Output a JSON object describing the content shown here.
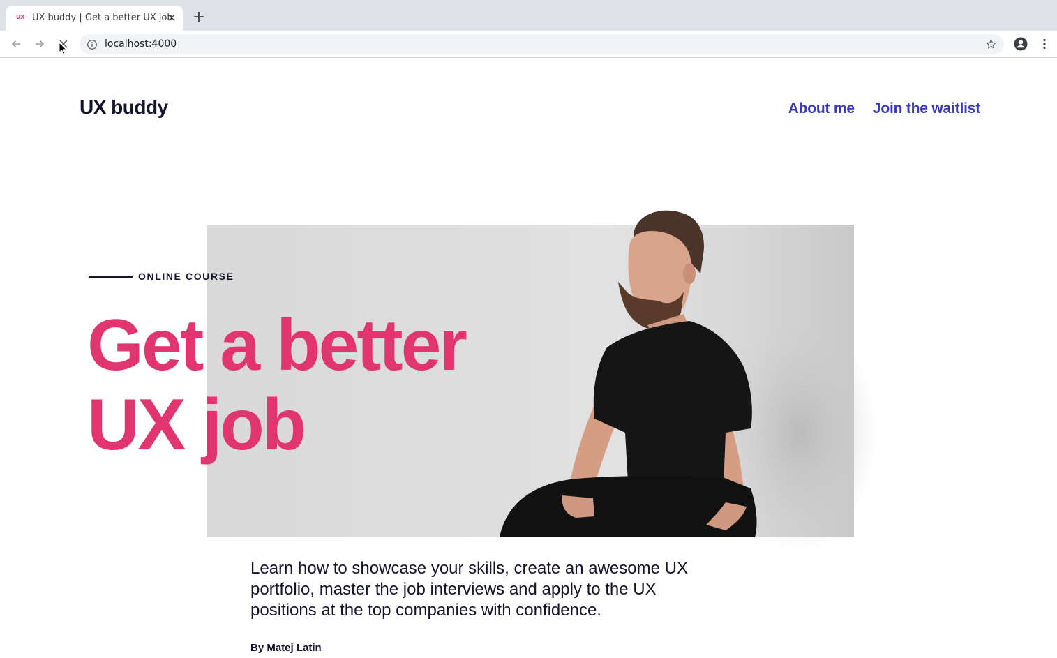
{
  "browser": {
    "tab": {
      "favicon": "UX",
      "title": "UX buddy | Get a better UX job.",
      "close": "×"
    },
    "new_tab": "+",
    "url": "localhost:4000",
    "icons": {
      "back": "arrow-left-icon",
      "forward": "arrow-right-icon",
      "stop": "close-icon",
      "info": "info-icon",
      "bookmark": "star-icon",
      "profile": "account-icon",
      "menu": "more-vert-icon"
    }
  },
  "site": {
    "logo": "UX buddy",
    "nav": [
      {
        "label": "About me"
      },
      {
        "label": "Join the waitlist"
      }
    ]
  },
  "hero": {
    "eyebrow": "ONLINE COURSE",
    "headline": [
      "Get a better",
      "UX job"
    ],
    "lead": "Learn how to showcase your skills, create an awesome UX portfolio, master the job interviews and apply to the UX positions at the top companies with confidence.",
    "byline": "By Matej Latin"
  },
  "colors": {
    "accent_pink": "#e0356f",
    "link_blue": "#3a3ab8",
    "ink": "#14142b"
  }
}
